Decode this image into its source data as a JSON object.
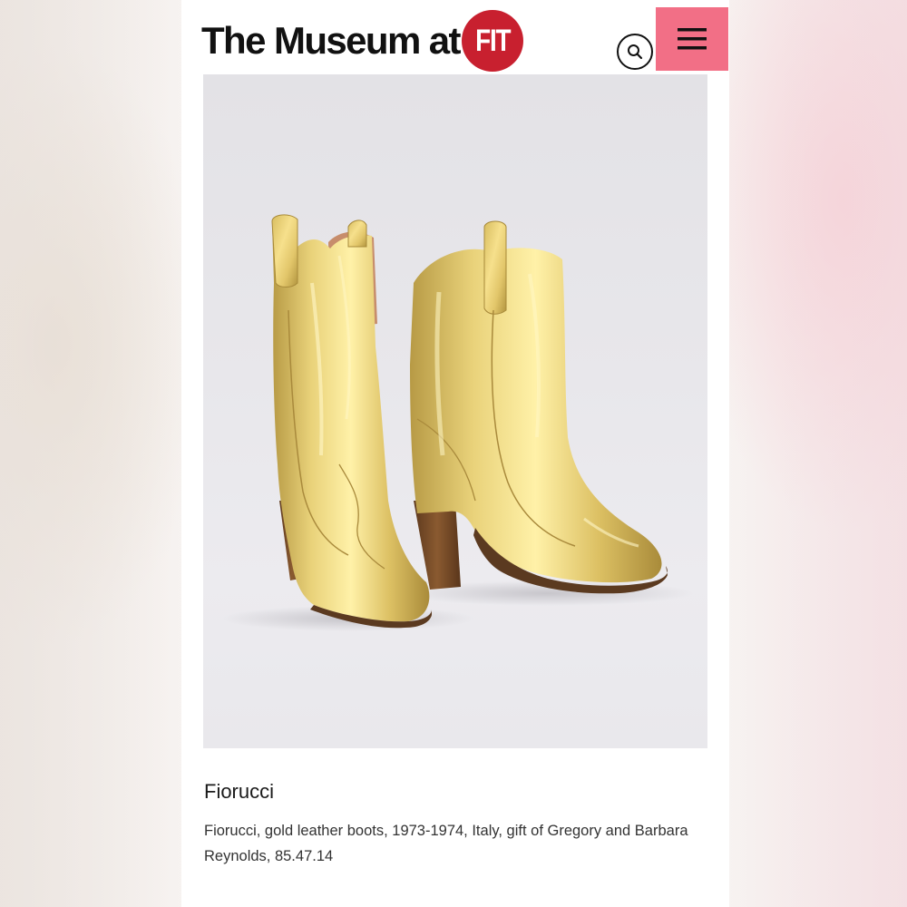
{
  "header": {
    "logo_text": "The Museum at",
    "logo_badge": "FIT",
    "brand_red": "#c8202f",
    "search_icon": "search-icon",
    "menu_icon": "hamburger-menu-icon",
    "menu_color": "#f26f86"
  },
  "artwork": {
    "subject": "gold leather boots"
  },
  "object": {
    "title": "Fiorucci",
    "caption": "Fiorucci, gold leather boots, 1973-1974, Italy, gift of Gregory and Barbara Reynolds, 85.47.14"
  }
}
